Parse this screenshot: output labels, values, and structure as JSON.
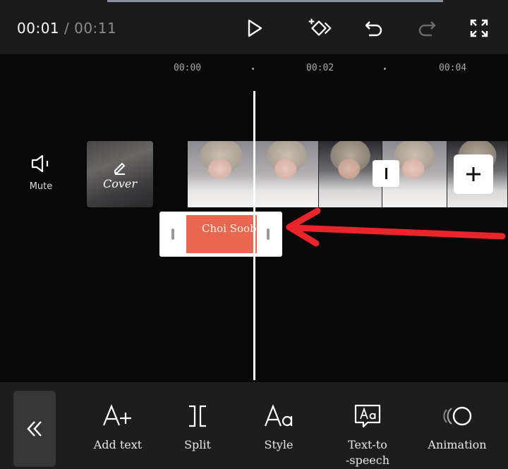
{
  "player": {
    "current_time": "00:01",
    "separator": "/",
    "total_time": "00:11"
  },
  "toolbar": {
    "play_icon": "play-icon",
    "keyframe_icon": "keyframe-icon",
    "undo_icon": "undo-icon",
    "redo_icon": "redo-icon",
    "fullscreen_icon": "fullscreen-icon"
  },
  "ruler": {
    "ticks": [
      "00:00",
      "00:02",
      "00:04"
    ]
  },
  "track": {
    "mute_label": "Mute",
    "cover_label": "Cover",
    "text_clip_label": "Choi Soob"
  },
  "colors": {
    "text_clip": "#e8674f",
    "arrow": "#e9252b",
    "background": "#080808"
  },
  "tools": [
    {
      "label": "Add text",
      "icon": "add-text-icon"
    },
    {
      "label": "Split",
      "icon": "split-icon"
    },
    {
      "label": "Style",
      "icon": "style-icon"
    },
    {
      "label": "Text-to\n-speech",
      "icon": "text-to-speech-icon"
    },
    {
      "label": "Animation",
      "icon": "animation-icon"
    }
  ]
}
